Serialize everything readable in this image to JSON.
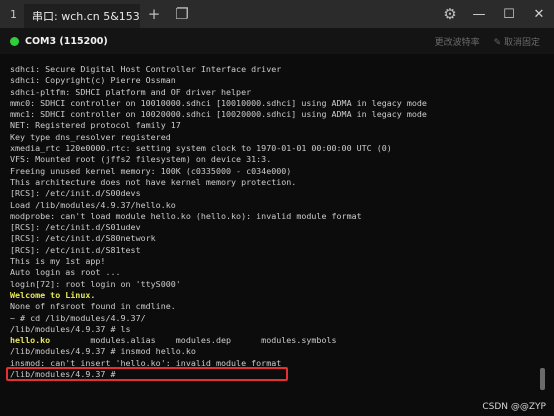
{
  "titlebar": {
    "tab_index": "1",
    "tab_title": "串口: wch.cn 5&1536...",
    "tab_close": "×",
    "new_tab": "+",
    "window_icon": "❐",
    "settings_icon": "⚙",
    "minimize": "—",
    "maximize": "☐",
    "close": "✕"
  },
  "status": {
    "port": "COM3 (115200)",
    "change_baud": "更改波特率",
    "unpin": "✎ 取消固定",
    "indicator_color": "#2fcf3a"
  },
  "terminal": {
    "lines": [
      "sdhci: Secure Digital Host Controller Interface driver",
      "sdhci: Copyright(c) Pierre Ossman",
      "sdhci-pltfm: SDHCI platform and OF driver helper",
      "mmc0: SDHCI controller on 10010000.sdhci [10010000.sdhci] using ADMA in legacy mode",
      "mmc1: SDHCI controller on 10020000.sdhci [10020000.sdhci] using ADMA in legacy mode",
      "NET: Registered protocol family 17",
      "Key type dns_resolver registered",
      "xmedia_rtc 120e0000.rtc: setting system clock to 1970-01-01 00:00:00 UTC (0)",
      "VFS: Mounted root (jffs2 filesystem) on device 31:3.",
      "Freeing unused kernel memory: 100K (c0335000 - c034e000)",
      "This architecture does not have kernel memory protection.",
      "[RCS]: /etc/init.d/S00devs",
      "Load /lib/modules/4.9.37/hello.ko",
      "modprobe: can't load module hello.ko (hello.ko): invalid module format",
      "[RCS]: /etc/init.d/S01udev",
      "[RCS]: /etc/init.d/S80network",
      "[RCS]: /etc/init.d/S81test",
      "This is my 1st app!",
      "Auto login as root ...",
      "login[72]: root login on 'ttyS000'",
      "Welcome to Linux.",
      "None of nfsroot found in cmdline.",
      "~ # cd /lib/modules/4.9.37/",
      "/lib/modules/4.9.37 # ls",
      "hello.ko        modules.alias    modules.dep      modules.symbols",
      "/lib/modules/4.9.37 # insmod hello.ko",
      "insmod: can't insert 'hello.ko': invalid module format",
      "/lib/modules/4.9.37 #"
    ],
    "highlighted_lines": [
      20,
      24
    ],
    "error_line_index": 26
  },
  "watermark": "CSDN @@ZYP"
}
